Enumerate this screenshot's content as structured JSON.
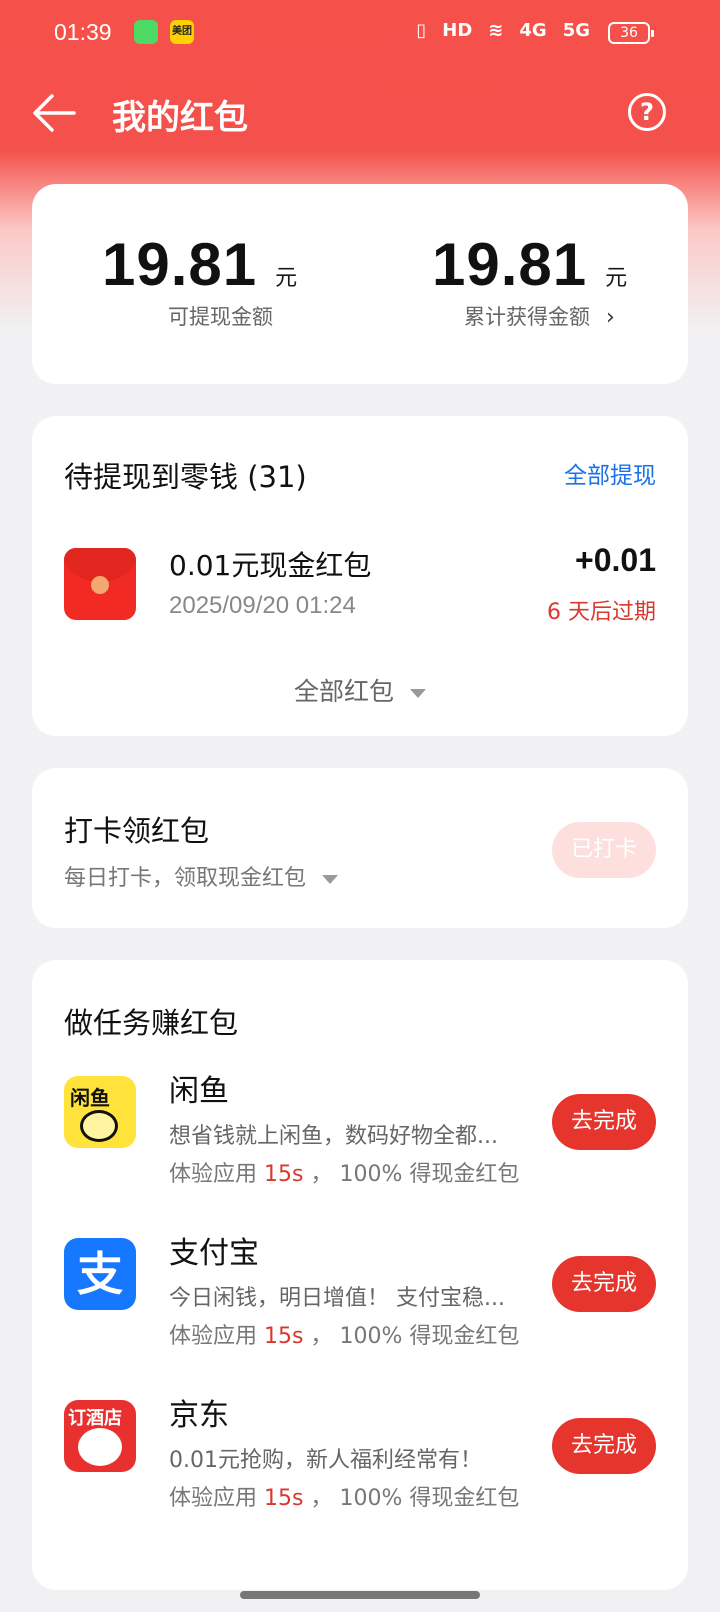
{
  "status_bar": {
    "time": "01:39",
    "notif_meituan": "美团",
    "hd": "HD",
    "net1": "4G",
    "net2": "5G",
    "battery": "36"
  },
  "header": {
    "title": "我的红包",
    "help": "?"
  },
  "summary": {
    "withdrawable_amount": "19.81",
    "withdrawable_unit": "元",
    "withdrawable_label": "可提现金额",
    "total_amount": "19.81",
    "total_unit": "元",
    "total_label": "累计获得金额"
  },
  "pending": {
    "title": "待提现到零钱 (31)",
    "withdraw_all": "全部提现",
    "item": {
      "title": "0.01元现金红包",
      "date": "2025/09/20 01:24",
      "amount": "+0.01",
      "expire": "6 天后过期"
    },
    "all_packets": "全部红包"
  },
  "checkin": {
    "title": "打卡领红包",
    "subtitle": "每日打卡，领取现金红包",
    "button": "已打卡"
  },
  "tasks": {
    "title": "做任务赚红包",
    "items": [
      {
        "icon_text": "闲鱼",
        "name": "闲鱼",
        "desc": "想省钱就上闲鱼，数码好物全都...",
        "reward_prefix": "体验应用 ",
        "reward_sec": "15s",
        "reward_suffix": " ， 100% 得现金红包",
        "button": "去完成"
      },
      {
        "icon_text": "支",
        "name": "支付宝",
        "desc": "今日闲钱，明日增值！ 支付宝稳...",
        "reward_prefix": "体验应用 ",
        "reward_sec": "15s",
        "reward_suffix": " ， 100% 得现金红包",
        "button": "去完成"
      },
      {
        "icon_text": "订酒店",
        "name": "京东",
        "desc": "0.01元抢购，新人福利经常有！",
        "reward_prefix": "体验应用 ",
        "reward_sec": "15s",
        "reward_suffix": " ， 100% 得现金红包",
        "button": "去完成"
      }
    ]
  },
  "colors": {
    "header_red": "#f5504a",
    "action_red": "#e5352c",
    "link_blue": "#1a73e8",
    "expire_red": "#d9382e"
  }
}
